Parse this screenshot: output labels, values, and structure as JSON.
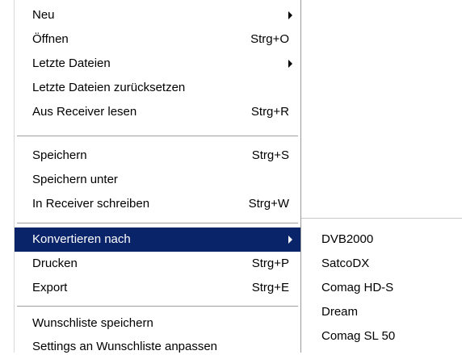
{
  "menu": {
    "items": [
      {
        "label": "Neu",
        "shortcut": ""
      },
      {
        "label": "Öffnen",
        "shortcut": "Strg+O"
      },
      {
        "label": "Letzte Dateien",
        "shortcut": ""
      },
      {
        "label": "Letzte Dateien zurücksetzen",
        "shortcut": ""
      },
      {
        "label": "Aus Receiver lesen",
        "shortcut": "Strg+R"
      },
      {
        "label": "Speichern",
        "shortcut": "Strg+S"
      },
      {
        "label": "Speichern unter",
        "shortcut": ""
      },
      {
        "label": "In Receiver schreiben",
        "shortcut": "Strg+W"
      },
      {
        "label": "Konvertieren nach",
        "shortcut": ""
      },
      {
        "label": "Drucken",
        "shortcut": "Strg+P"
      },
      {
        "label": "Export",
        "shortcut": "Strg+E"
      },
      {
        "label": "Wunschliste speichern",
        "shortcut": ""
      },
      {
        "label": "Settings an Wunschliste anpassen",
        "shortcut": ""
      }
    ]
  },
  "submenu": {
    "parent": "Konvertieren nach",
    "items": [
      "DVB2000",
      "SatcoDX",
      "Comag HD-S",
      "Dream",
      "Comag SL 50"
    ]
  },
  "colors": {
    "highlight_bg": "#0a246a",
    "highlight_text": "#ffffff",
    "menu_bg": "#ffffff"
  }
}
